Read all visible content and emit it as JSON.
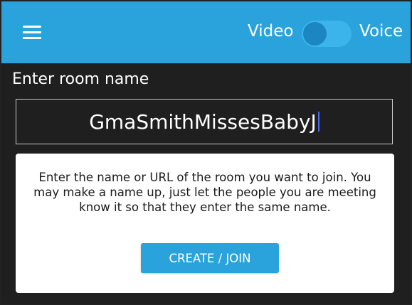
{
  "header": {
    "menu_icon": "hamburger-menu-icon",
    "mode_toggle": {
      "left_label": "Video",
      "right_label": "Voice",
      "selected": "Video"
    }
  },
  "room": {
    "label": "Enter room name",
    "input_value": "GmaSmithMissesBabyJ"
  },
  "info_card": {
    "text": "Enter the name or URL of the room you want to join. You may make a name up, just let the people you are meeting know it so that they enter the same name.",
    "join_button_label": "CREATE / JOIN"
  },
  "colors": {
    "accent": "#2aa3dc",
    "background": "#1f1f1f",
    "card": "#ffffff",
    "toggle_knob": "#1c86c2"
  }
}
